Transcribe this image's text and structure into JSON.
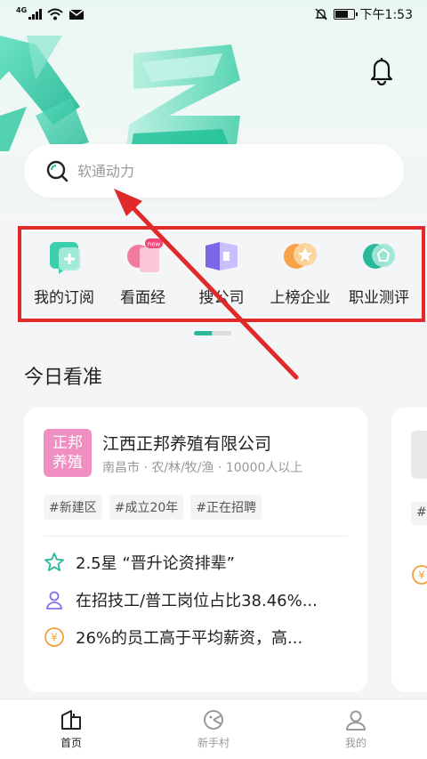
{
  "status_bar": {
    "network": "4G",
    "time": "下午1:53"
  },
  "search": {
    "placeholder": "软通动力"
  },
  "quick_menu": [
    {
      "label": "我的订阅",
      "icon": "subscribe-icon"
    },
    {
      "label": "看面经",
      "icon": "interview-icon",
      "badge": "new"
    },
    {
      "label": "搜公司",
      "icon": "company-search-icon"
    },
    {
      "label": "上榜企业",
      "icon": "ranking-icon"
    },
    {
      "label": "职业测评",
      "icon": "assessment-icon"
    }
  ],
  "section_title": "今日看准",
  "card": {
    "logo_text": "正邦养殖",
    "company_name": "江西正邦养殖有限公司",
    "meta": "南昌市 · 农/林/牧/渔 · 10000人以上",
    "tags": [
      "#新建区",
      "#成立20年",
      "#正在招聘"
    ],
    "rows": [
      {
        "icon": "star-icon",
        "text": "2.5星 “晋升论资排辈”"
      },
      {
        "icon": "worker-icon",
        "text": "在招技工/普工岗位占比38.46%..."
      },
      {
        "icon": "salary-icon",
        "text": " 26%的员工高于平均薪资，高..."
      }
    ]
  },
  "card2": {
    "tag_prefix": "#"
  },
  "bottom_nav": [
    {
      "label": "首页",
      "active": true
    },
    {
      "label": "新手村",
      "active": false
    },
    {
      "label": "我的",
      "active": false
    }
  ],
  "colors": {
    "accent": "#2bb89a",
    "highlight_box": "#e02a2a"
  }
}
